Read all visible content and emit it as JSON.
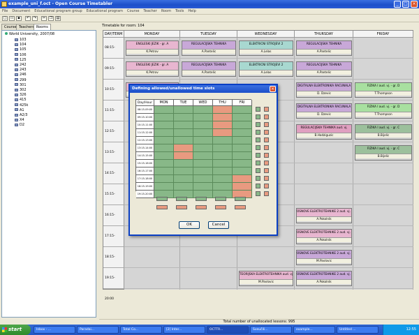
{
  "window": {
    "title": "example_uni_f.oct - Open Course Timetabler"
  },
  "menu": [
    "File",
    "Document",
    "Educational program group",
    "Educational program",
    "Course",
    "Teacher",
    "Room",
    "Tools",
    "Help"
  ],
  "left_tabs": [
    "Courses",
    "Teachers",
    "Rooms"
  ],
  "tree": {
    "root": "World University, 2007/08",
    "rooms": [
      "103",
      "104",
      "105",
      "106",
      "125",
      "242",
      "243",
      "246",
      "299",
      "301",
      "302",
      "326",
      "415",
      "425k",
      "A1",
      "A2/3",
      "X4",
      "D2"
    ]
  },
  "timetable": {
    "caption": "Timetable for room: 104",
    "corner": "DAY/TERM",
    "days": [
      "MONDAY",
      "TUESDAY",
      "WEDNESDAY",
      "THURSDAY",
      "FRIDAY"
    ],
    "times": [
      "08:15-09:00",
      "09:15-10:00",
      "10:15-11:00",
      "11:15-12:00",
      "12:15-13:00",
      "13:15-14:00",
      "14:15-15:00",
      "15:15-16:00",
      "16:15-17:00",
      "17:15-18:00",
      "18:15-19:00",
      "19:15-20:00"
    ]
  },
  "lessons": [
    {
      "name": "ENGLESKI JEZIK - gr. A",
      "teacher": "K.Petrov",
      "day": 0,
      "slot": 0,
      "len": 1,
      "color": "pink"
    },
    {
      "name": "ENGLESKI JEZIK - gr. A",
      "teacher": "K.Petrov",
      "day": 0,
      "slot": 1,
      "len": 1,
      "color": "pink"
    },
    {
      "name": "ENGLESKI JEZIK - gr. A",
      "teacher": "K.Petrov",
      "day": 0,
      "slot": 2,
      "len": 1,
      "color": "pink"
    },
    {
      "name": "REGULACIJSKA TEHNIKA",
      "teacher": "A.Pantelic",
      "day": 1,
      "slot": 0,
      "len": 1,
      "color": "lilac"
    },
    {
      "name": "REGULACIJSKA TEHNIKA",
      "teacher": "A.Pantelic",
      "day": 1,
      "slot": 1,
      "len": 1,
      "color": "lilac"
    },
    {
      "name": "ELEKTRICNI STROJEVI 2",
      "teacher": "A.Lelas",
      "day": 2,
      "slot": 0,
      "len": 1,
      "color": "teal"
    },
    {
      "name": "ELEKTRICNI STROJEVI 2",
      "teacher": "A.Lelas",
      "day": 2,
      "slot": 1,
      "len": 1,
      "color": "teal"
    },
    {
      "name": "REGULACIJSKA TEHNIKA",
      "teacher": "A.Pantelic",
      "day": 3,
      "slot": 0,
      "len": 1,
      "color": "lilac"
    },
    {
      "name": "REGULACIJSKA TEHNIKA",
      "teacher": "A.Pantelic",
      "day": 3,
      "slot": 1,
      "len": 1,
      "color": "lilac"
    },
    {
      "name": "DIGITALNA ELEKTRONIKA RACUNALA",
      "teacher": "D. Dzevic",
      "day": 3,
      "slot": 2,
      "len": 1,
      "color": "lilac"
    },
    {
      "name": "DIGITALNA ELEKTRONIKA RACUNALA",
      "teacher": "D. Dzevic",
      "day": 3,
      "slot": 3,
      "len": 1,
      "color": "lilac"
    },
    {
      "name": "REGULACIJSKA TEHNIKA aud. vj.",
      "teacher": "B.Hadziguzic",
      "day": 3,
      "slot": 4,
      "len": 1,
      "color": "rose"
    },
    {
      "name": "FIZIKA I aud. vj. - gr. D",
      "teacher": "T.Thompson",
      "day": 4,
      "slot": 2,
      "len": 1,
      "color": "green"
    },
    {
      "name": "FIZIKA I aud. vj. - gr. D",
      "teacher": "T.Thompson",
      "day": 4,
      "slot": 3,
      "len": 1,
      "color": "green"
    },
    {
      "name": "FIZIKA I aud. vj. - gr. C",
      "teacher": "B.Bijelic",
      "day": 4,
      "slot": 4,
      "len": 1,
      "color": "sage"
    },
    {
      "name": "FIZIKA I aud. vj. - gr. C",
      "teacher": "B.Bijelic",
      "day": 4,
      "slot": 5,
      "len": 1,
      "color": "sage"
    },
    {
      "name": "OSNOVE ELEKTROTEHNIKE 2 aud. vj. - gr. A",
      "teacher": "A.Pokolnik",
      "day": 3,
      "slot": 8,
      "len": 1,
      "color": "pink"
    },
    {
      "name": "OSNOVE ELEKTROTEHNIKE 2 aud. vj. - gr. A",
      "teacher": "A.Pokolnik",
      "day": 3,
      "slot": 9,
      "len": 1,
      "color": "pink"
    },
    {
      "name": "OSNOVE ELEKTROTEHNIKE 2 aud. vj. - gr. B",
      "teacher": "M.Pavlovic",
      "day": 3,
      "slot": 10,
      "len": 1,
      "color": "lilac"
    },
    {
      "name": "TEORIJSKA ELEKTROTEHNIKA aud. vj. - gr. B",
      "teacher": "M.Pavlovic",
      "day": 2,
      "slot": 11,
      "len": 1,
      "color": "pink"
    },
    {
      "name": "OSNOVE ELEKTROTEHNIKE 2 aud. vj. - gr. B",
      "teacher": "A.Pokolnik",
      "day": 3,
      "slot": 11,
      "len": 1,
      "color": "lilac"
    }
  ],
  "dialog": {
    "title": "Defining allowed/unallowed time slots",
    "corner": "Day/Hour",
    "days": [
      "MON",
      "TUE",
      "WED",
      "THU",
      "FRI"
    ],
    "times": [
      "08:15-09:00",
      "09:15-10:00",
      "10:15-11:00",
      "11:15-12:00",
      "12:15-13:00",
      "13:15-14:00",
      "14:15-15:00",
      "15:15-16:00",
      "16:15-17:00",
      "17:15-18:00",
      "18:15-19:00",
      "19:15-20:00"
    ],
    "slots": [
      [
        1,
        1,
        1,
        0,
        1
      ],
      [
        1,
        1,
        1,
        0,
        1
      ],
      [
        1,
        1,
        1,
        0,
        1
      ],
      [
        1,
        1,
        1,
        0,
        1
      ],
      [
        1,
        1,
        1,
        1,
        1
      ],
      [
        1,
        0,
        1,
        1,
        1
      ],
      [
        1,
        0,
        1,
        1,
        1
      ],
      [
        1,
        1,
        1,
        1,
        1
      ],
      [
        1,
        1,
        1,
        1,
        1
      ],
      [
        1,
        1,
        1,
        1,
        0
      ],
      [
        1,
        1,
        1,
        1,
        0
      ],
      [
        1,
        1,
        1,
        1,
        0
      ]
    ],
    "ok": "OK",
    "cancel": "Cancel"
  },
  "status": "Total number of unallocated lessons: 995",
  "taskbar": {
    "start": "start",
    "tasks": [
      "Inbox - ...",
      "Paradai...",
      "Total Co...",
      "[2] Inter...",
      "OCTTR...",
      "Sveučili...",
      "example...",
      "Untitled ..."
    ],
    "clock": "12:55"
  },
  "colors": {
    "allowed": "#88b888",
    "denied": "#e89a80",
    "titlebar": "#1c4fc9"
  }
}
